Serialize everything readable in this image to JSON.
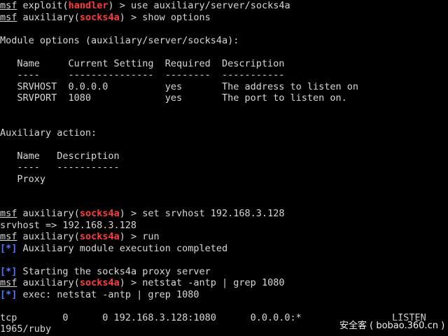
{
  "prompt": {
    "msf": "msf",
    "exploit": "exploit",
    "handler": "handler",
    "aux": "auxiliary",
    "socks4a": "socks4a"
  },
  "commands": {
    "use": " > use auxiliary/server/socks4a",
    "show": " > show options",
    "set": " > set srvhost 192.168.3.128",
    "run": " > run",
    "netstat": " > netstat -antp | grep 1080"
  },
  "module_options": {
    "heading": "Module options (auxiliary/server/socks4a):",
    "header": "   Name     Current Setting  Required  Description",
    "rule": "   ----     ---------------  --------  -----------",
    "rows": [
      "   SRVHOST  0.0.0.0          yes       The address to listen on",
      "   SRVPORT  1080             yes       The port to listen on."
    ]
  },
  "aux_action": {
    "heading": "Auxiliary action:",
    "header": "   Name   Description",
    "rule": "   ----   -----------",
    "row": "   Proxy"
  },
  "output": {
    "srvhost": "srvhost => 192.168.3.128",
    "status_tag": "[*]",
    "completed": " Auxiliary module execution completed",
    "starting": " Starting the socks4a proxy server",
    "exec": " exec: netstat -antp | grep 1080",
    "tcp": "tcp        0      0 192.168.3.128:1080      0.0.0.0:*",
    "listen": "LISTEN",
    "ruby": "1965/ruby"
  },
  "watermark": "安全客 ( bobao.360.cn )"
}
